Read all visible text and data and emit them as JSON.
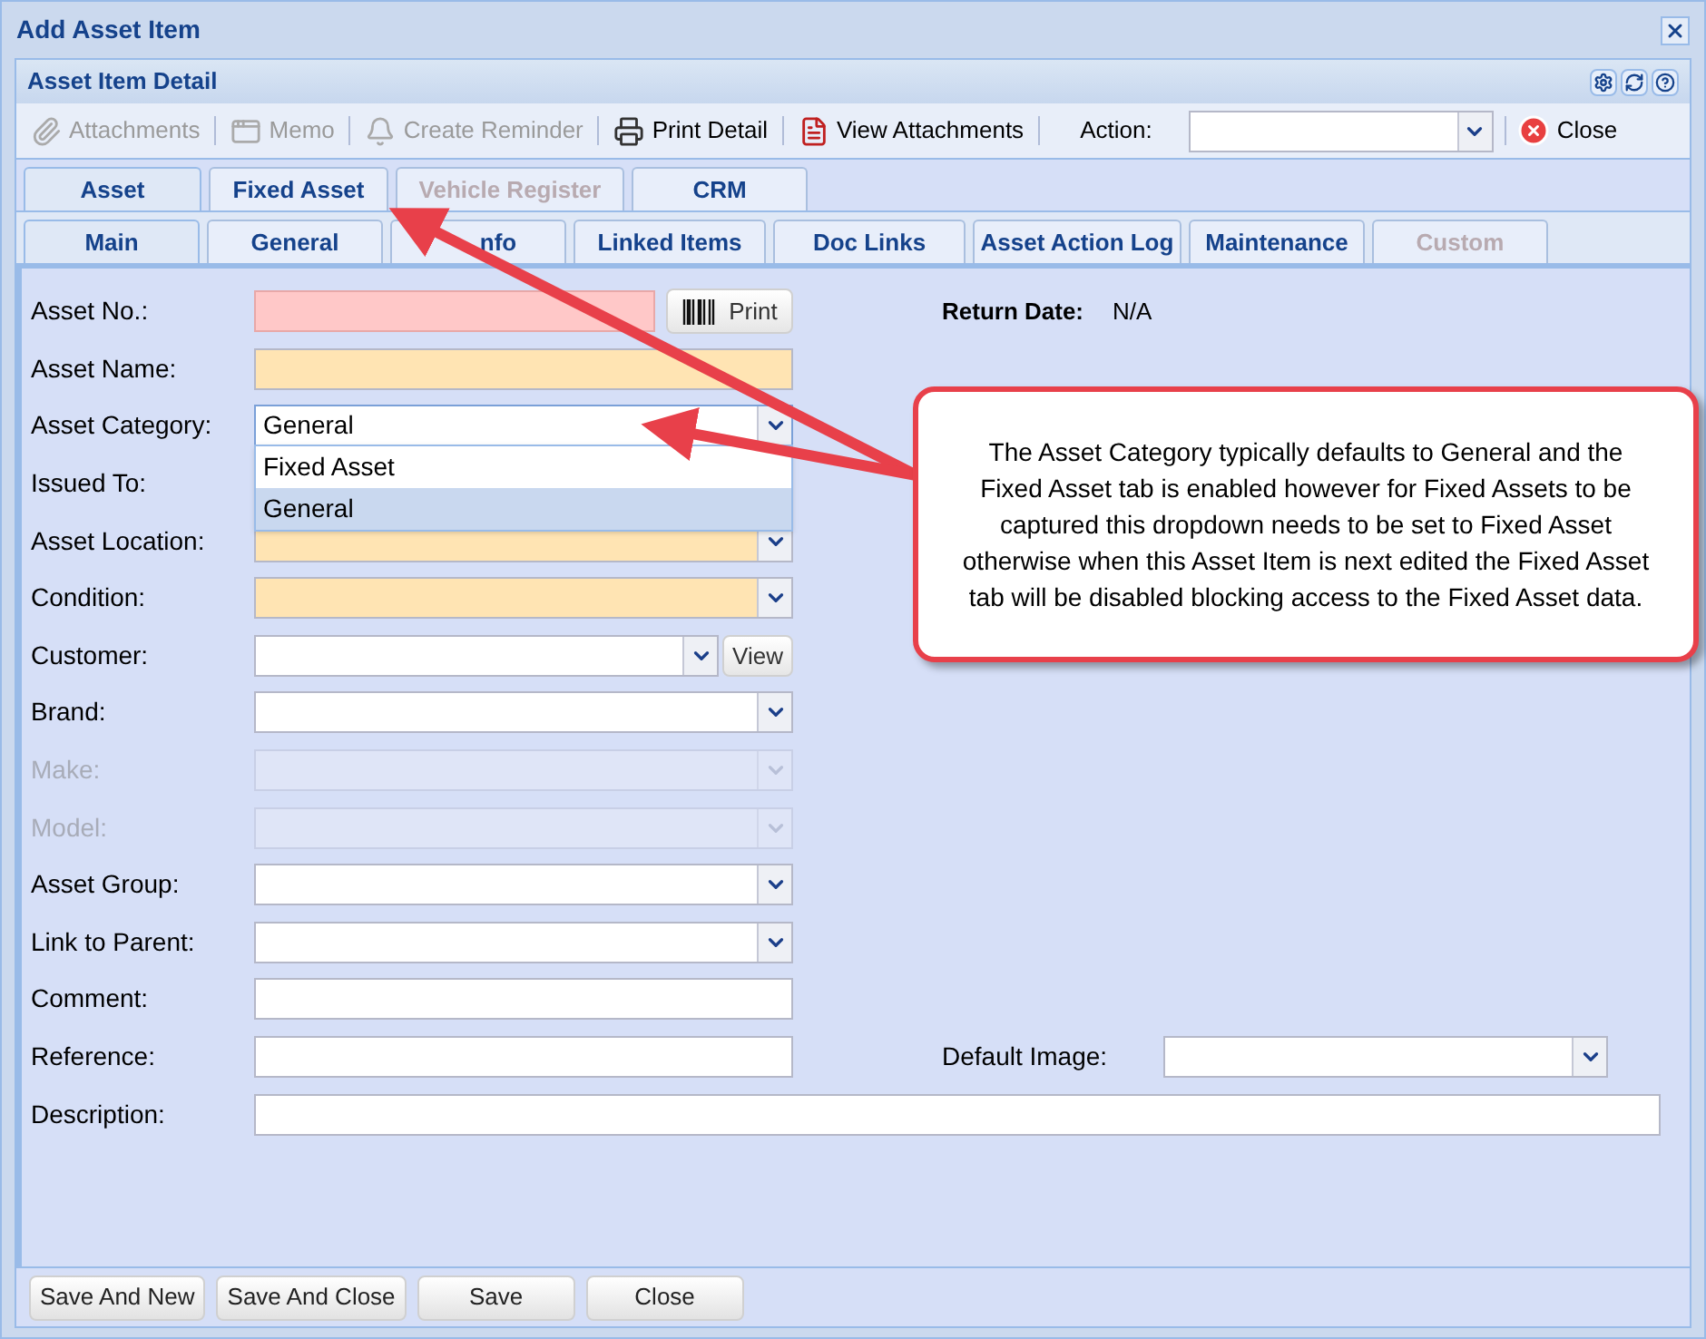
{
  "window": {
    "title": "Add Asset Item"
  },
  "panel": {
    "title": "Asset Item Detail"
  },
  "toolbar": {
    "items": [
      {
        "label": "Attachments",
        "disabled": true
      },
      {
        "label": "Memo",
        "disabled": true
      },
      {
        "label": "Create Reminder",
        "disabled": true
      },
      {
        "label": "Print Detail",
        "disabled": false
      },
      {
        "label": "View Attachments",
        "disabled": false
      }
    ],
    "action_label": "Action:",
    "close_label": "Close"
  },
  "tabs": [
    {
      "label": "Asset",
      "selected": true,
      "disabled": false
    },
    {
      "label": "Fixed Asset",
      "selected": false,
      "disabled": false
    },
    {
      "label": "Vehicle Register",
      "selected": false,
      "disabled": true
    },
    {
      "label": "CRM",
      "selected": false,
      "disabled": false
    }
  ],
  "subtabs": [
    {
      "label": "Main",
      "selected": true,
      "disabled": false
    },
    {
      "label": "General",
      "selected": false,
      "disabled": false
    },
    {
      "label": "nfo",
      "selected": false,
      "disabled": false
    },
    {
      "label": "Linked Items",
      "selected": false,
      "disabled": false
    },
    {
      "label": "Doc Links",
      "selected": false,
      "disabled": false
    },
    {
      "label": "Asset Action Log",
      "selected": false,
      "disabled": false
    },
    {
      "label": "Maintenance",
      "selected": false,
      "disabled": false
    },
    {
      "label": "Custom",
      "selected": false,
      "disabled": true
    }
  ],
  "form": [
    {
      "label": "Asset No.:",
      "kind": "print",
      "color": "#ffc8c8",
      "button": "Print",
      "disabled": false,
      "side": {
        "label": "Return Date:",
        "value": "N/A"
      }
    },
    {
      "label": "Asset Name:",
      "kind": "text",
      "color": "#ffe4b3",
      "disabled": false
    },
    {
      "label": "Asset Category:",
      "kind": "combo",
      "value": "General",
      "disabled": false,
      "options": [
        {
          "label": "Fixed Asset",
          "selected": false
        },
        {
          "label": "General",
          "selected": true
        }
      ]
    },
    {
      "label": "Issued To:",
      "kind": "covered",
      "disabled": false
    },
    {
      "label": "Asset Location:",
      "kind": "combo",
      "color": "#ffe4b3",
      "disabled": false
    },
    {
      "label": "Condition:",
      "kind": "combo",
      "color": "#ffe4b3",
      "disabled": false
    },
    {
      "label": "Customer:",
      "kind": "combo_view",
      "button": "View",
      "disabled": false
    },
    {
      "label": "Brand:",
      "kind": "combo",
      "disabled": false
    },
    {
      "label": "Make:",
      "kind": "combo",
      "disabled": true
    },
    {
      "label": "Model:",
      "kind": "combo",
      "disabled": true
    },
    {
      "label": "Asset Group:",
      "kind": "combo",
      "disabled": false
    },
    {
      "label": "Link to Parent:",
      "kind": "combo",
      "disabled": false
    },
    {
      "label": "Comment:",
      "kind": "text",
      "disabled": false
    },
    {
      "label": "Reference:",
      "kind": "text",
      "disabled": false,
      "side": {
        "label": "Default Image:",
        "kind": "combo"
      }
    },
    {
      "label": "Description:",
      "kind": "wide",
      "disabled": false
    }
  ],
  "callout": {
    "text": "The Asset Category typically defaults to General and the Fixed Asset tab is enabled however for Fixed Assets to be captured this dropdown needs to be set to Fixed Asset otherwise when this Asset Item is next edited the Fixed Asset tab will be disabled blocking access to the Fixed Asset data."
  },
  "buttons": [
    "Save And New",
    "Save And Close",
    "Save",
    "Close"
  ]
}
